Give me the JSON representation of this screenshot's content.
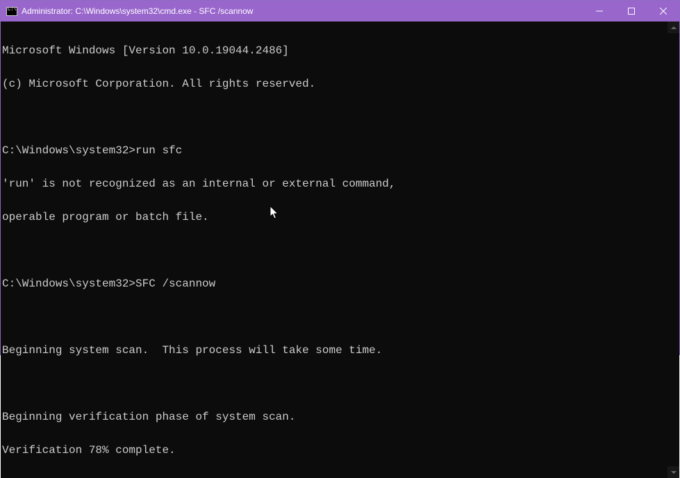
{
  "window": {
    "title": "Administrator: C:\\Windows\\system32\\cmd.exe - SFC  /scannow"
  },
  "terminal": {
    "lines": [
      "Microsoft Windows [Version 10.0.19044.2486]",
      "(c) Microsoft Corporation. All rights reserved.",
      "",
      "C:\\Windows\\system32>run sfc",
      "'run' is not recognized as an internal or external command,",
      "operable program or batch file.",
      "",
      "C:\\Windows\\system32>SFC /scannow",
      "",
      "Beginning system scan.  This process will take some time.",
      "",
      "Beginning verification phase of system scan.",
      "Verification 78% complete."
    ]
  }
}
